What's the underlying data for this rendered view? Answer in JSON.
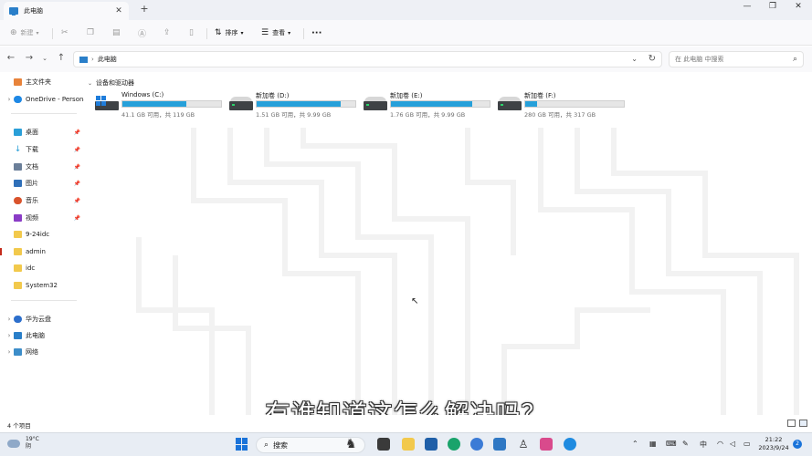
{
  "tab": {
    "title": "此电脑"
  },
  "toolbar": {
    "new": "新建",
    "sort": "排序",
    "view": "查看",
    "more": "···"
  },
  "address": {
    "path": "此电脑",
    "search_placeholder": "在 此电脑 中搜索"
  },
  "sidebar": {
    "items": [
      {
        "label": "主文件夹",
        "icon": "home-icon",
        "expandable": false,
        "pinned": false
      },
      {
        "label": "OneDrive - Personal",
        "icon": "cloud-icon",
        "expandable": true,
        "pinned": false
      },
      {
        "label": "桌面",
        "icon": "desktop-icon",
        "expandable": false,
        "pinned": true
      },
      {
        "label": "下载",
        "icon": "download-icon",
        "expandable": false,
        "pinned": true
      },
      {
        "label": "文档",
        "icon": "document-icon",
        "expandable": false,
        "pinned": true
      },
      {
        "label": "图片",
        "icon": "picture-icon",
        "expandable": false,
        "pinned": true
      },
      {
        "label": "音乐",
        "icon": "music-icon",
        "expandable": false,
        "pinned": true
      },
      {
        "label": "视频",
        "icon": "video-icon",
        "expandable": false,
        "pinned": true
      },
      {
        "label": "9-24idc",
        "icon": "folder-icon",
        "expandable": false,
        "pinned": false
      },
      {
        "label": "admin",
        "icon": "folder-icon",
        "expandable": false,
        "pinned": false
      },
      {
        "label": "idc",
        "icon": "folder-icon",
        "expandable": false,
        "pinned": false
      },
      {
        "label": "System32",
        "icon": "folder-icon",
        "expandable": false,
        "pinned": false
      },
      {
        "label": "华为云盘",
        "icon": "cloud-drive-icon",
        "expandable": true,
        "pinned": false
      },
      {
        "label": "此电脑",
        "icon": "computer-icon",
        "expandable": true,
        "pinned": false
      },
      {
        "label": "网络",
        "icon": "network-icon",
        "expandable": true,
        "pinned": false
      }
    ]
  },
  "main": {
    "group_header": "设备和驱动器",
    "drives": [
      {
        "name": "Windows (C:)",
        "info": "41.1 GB 可用，共 119 GB",
        "used_fraction": 0.65,
        "system": true
      },
      {
        "name": "新加卷 (D:)",
        "info": "1.51 GB 可用，共 9.99 GB",
        "used_fraction": 0.85,
        "system": false
      },
      {
        "name": "新加卷 (E:)",
        "info": "1.76 GB 可用，共 9.99 GB",
        "used_fraction": 0.82,
        "system": false
      },
      {
        "name": "新加卷 (F:)",
        "info": "280 GB 可用，共 317 GB",
        "used_fraction": 0.12,
        "system": false
      }
    ]
  },
  "subtitle": "有谁知道这怎么解决吗？",
  "status": {
    "item_count": "4 个项目"
  },
  "taskbar": {
    "temperature": "19°C",
    "weather": "阴",
    "search": "搜索",
    "ime": "中",
    "time": "21:22",
    "date": "2023/9/24",
    "notifications": "2"
  },
  "colors": {
    "accent": "#26a0da",
    "selection_marker": "#c42b1c",
    "windows_blue": "#1f7ddb"
  }
}
